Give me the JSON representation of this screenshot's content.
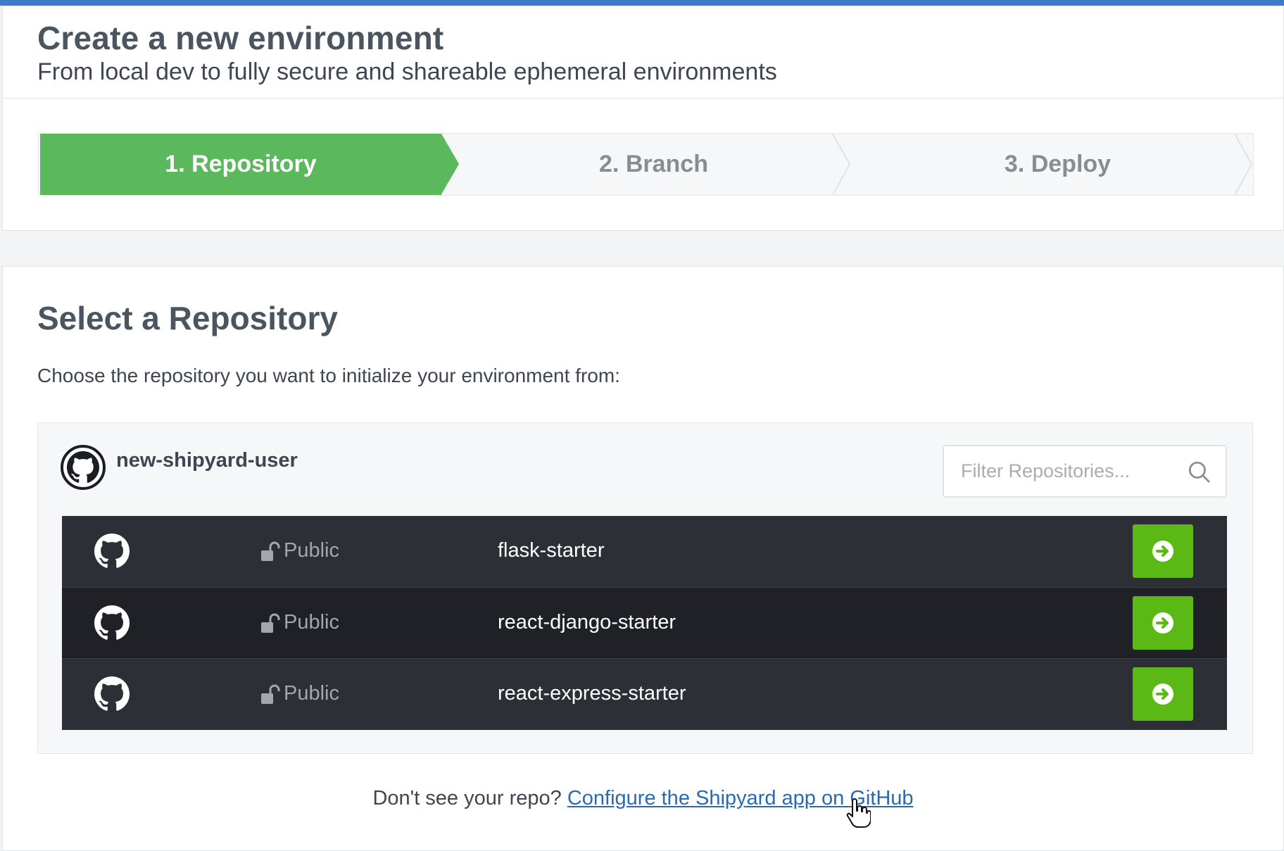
{
  "header": {
    "title": "Create a new environment",
    "subtitle": "From local dev to fully secure and shareable ephemeral environments"
  },
  "steps": [
    {
      "label": "1. Repository",
      "active": true
    },
    {
      "label": "2. Branch",
      "active": false
    },
    {
      "label": "3. Deploy",
      "active": false
    }
  ],
  "main": {
    "title": "Select a Repository",
    "description": "Choose the repository you want to initialize your environment from:"
  },
  "owner": {
    "name": "new-shipyard-user",
    "avatar_icon": "github-icon"
  },
  "filter": {
    "placeholder": "Filter Repositories...",
    "value": "",
    "icon": "search-icon"
  },
  "repositories": [
    {
      "visibility": "Public",
      "name": "flask-starter"
    },
    {
      "visibility": "Public",
      "name": "react-django-starter"
    },
    {
      "visibility": "Public",
      "name": "react-express-starter"
    }
  ],
  "footer": {
    "prefix": "Don't see your repo?",
    "link": "Configure the Shipyard app on GitHub"
  },
  "colors": {
    "accent_bar": "#3f7bc9",
    "step_active": "#5cb85c",
    "select_button": "#5ab915",
    "row_dark": "#2c2f35",
    "row_darker": "#1f2126",
    "link": "#2a6ab3"
  }
}
